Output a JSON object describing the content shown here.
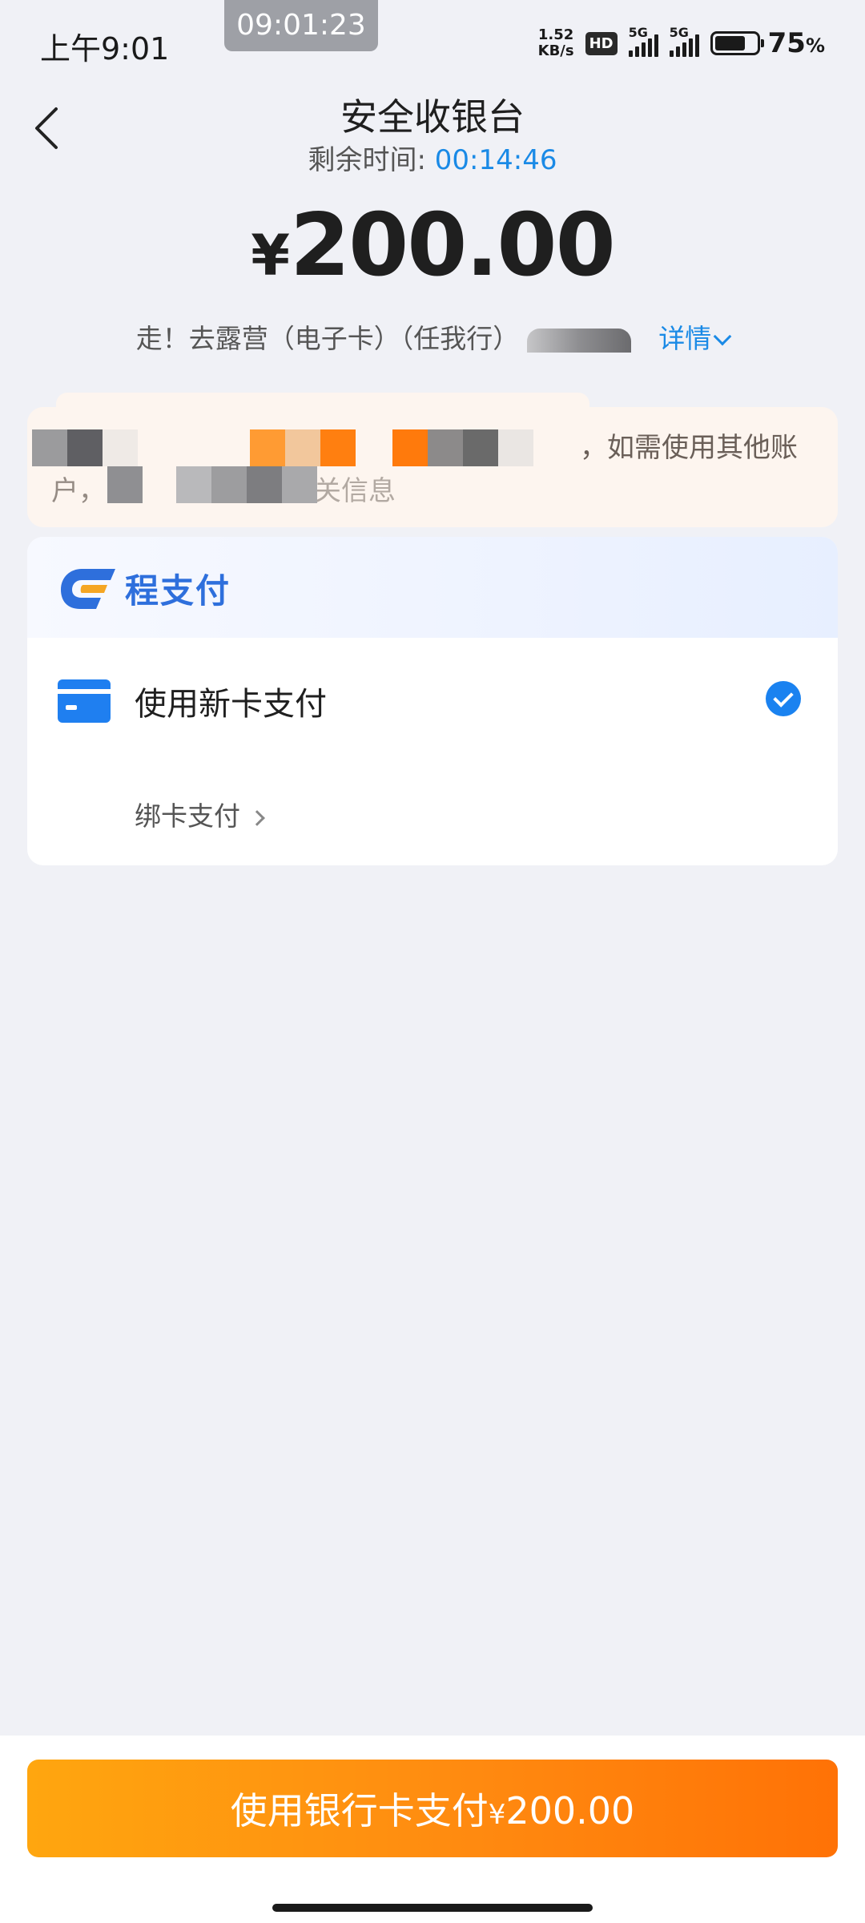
{
  "status_bar": {
    "time": "上午9:01",
    "recording_time": "09:01:23",
    "net_speed_value": "1.52",
    "net_speed_unit": "KB/s",
    "hd_label": "HD",
    "sim1_label": "5G",
    "sim2_label": "5G",
    "battery_percent_text": "75",
    "battery_percent_sign": "%",
    "battery_level": 0.75
  },
  "header": {
    "title": "安全收银台",
    "countdown_label": "剩余时间: ",
    "countdown_value": "00:14:46"
  },
  "order": {
    "currency": "¥",
    "amount": "200.00",
    "description": "走！去露营（电子卡）（任我行）",
    "details_label": "详情"
  },
  "notice": {
    "visible_text_tail": "，如需使用其他账",
    "line2_start": "户，",
    "line2_end": "关信息"
  },
  "payment": {
    "brand_name": "程支付",
    "new_card_label": "使用新卡支付",
    "new_card_selected": true,
    "bind_card_label": "绑卡支付"
  },
  "footer": {
    "pay_button_label": "使用银行卡支付",
    "pay_button_currency": "¥",
    "pay_button_amount": "200.00"
  },
  "colors": {
    "accent_blue": "#1a8ae6",
    "button_orange_start": "#ffa60f",
    "button_orange_end": "#ff7206",
    "notice_bg": "#fdf5ef"
  }
}
